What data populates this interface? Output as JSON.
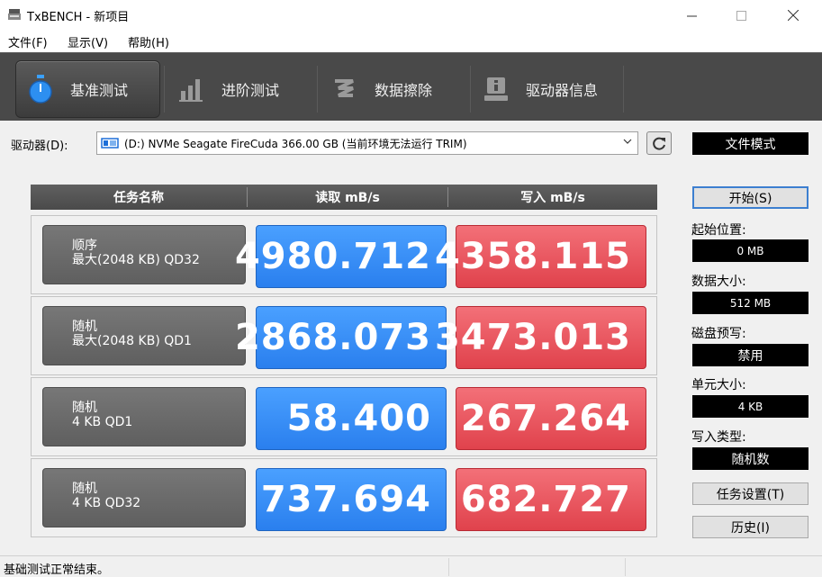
{
  "window": {
    "title": "TxBENCH - 新项目"
  },
  "menu": {
    "items": [
      "文件(F)",
      "显示(V)",
      "帮助(H)"
    ]
  },
  "tabs": [
    {
      "label": "基准测试",
      "icon": "stopwatch-icon",
      "active": true
    },
    {
      "label": "进阶测试",
      "icon": "bar-chart-icon",
      "active": false
    },
    {
      "label": "数据擦除",
      "icon": "erase-icon",
      "active": false
    },
    {
      "label": "驱动器信息",
      "icon": "drive-info-icon",
      "active": false
    }
  ],
  "drive": {
    "label": "驱动器(D):",
    "selected": "(D:) NVMe Seagate FireCuda  366.00 GB (当前环境无法运行 TRIM)"
  },
  "file_mode_label": "文件模式",
  "table": {
    "headers": [
      "任务名称",
      "读取 mB/s",
      "写入 mB/s"
    ],
    "rows": [
      {
        "line1": "顺序",
        "line2": "最大(2048 KB) QD32",
        "read": "4980.712",
        "write": "4358.115"
      },
      {
        "line1": "随机",
        "line2": "最大(2048 KB) QD1",
        "read": "2868.073",
        "write": "3473.013"
      },
      {
        "line1": "随机",
        "line2": "4 KB QD1",
        "read": "58.400",
        "write": "267.264"
      },
      {
        "line1": "随机",
        "line2": "4 KB QD32",
        "read": "737.694",
        "write": "682.727"
      }
    ]
  },
  "panel": {
    "start_label": "开始(S)",
    "start_pos_label": "起始位置:",
    "start_pos_value": "0 MB",
    "data_size_label": "数据大小:",
    "data_size_value": "512 MB",
    "precondition_label": "磁盘预写:",
    "precondition_value": "禁用",
    "unit_size_label": "单元大小:",
    "unit_size_value": "4 KB",
    "write_type_label": "写入类型:",
    "write_type_value": "随机数",
    "task_settings_label": "任务设置(T)",
    "history_label": "历史(I)"
  },
  "status": {
    "text": "基础测试正常结束。"
  },
  "colors": {
    "read_tile": "#2a7fee",
    "write_tile": "#e0424c",
    "toolbar_bg": "#494949"
  }
}
